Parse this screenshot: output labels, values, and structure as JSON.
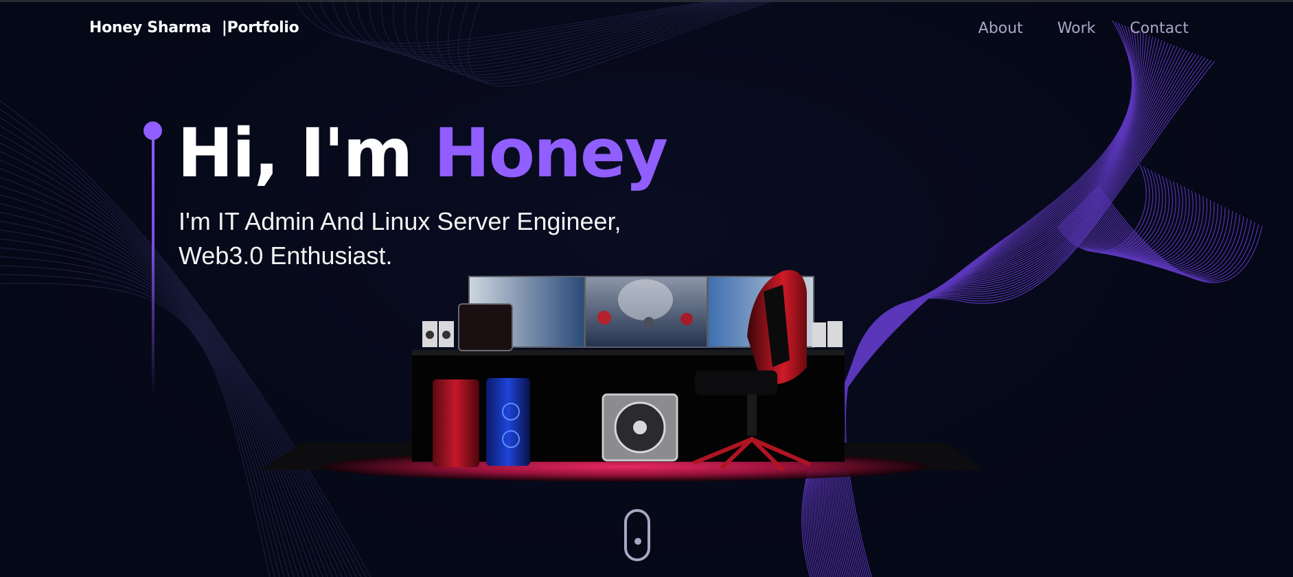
{
  "header": {
    "brand": "Honey Sharma",
    "separator": "|",
    "brand_suffix": "Portfolio",
    "nav": [
      {
        "label": "About"
      },
      {
        "label": "Work"
      },
      {
        "label": "Contact"
      }
    ]
  },
  "hero": {
    "greeting": "Hi, I'm",
    "name": "Honey",
    "subtitle_line1": "I'm IT Admin And Linux Server Engineer,",
    "subtitle_line2": "Web3.0 Enthusiast."
  },
  "scene": {
    "description_icon": "gaming-desk-setup-3d"
  },
  "colors": {
    "background": "#050816",
    "accent": "#915eff",
    "nav_text": "#a9a7c7",
    "text": "#ffffff"
  },
  "icons": {
    "scroll": "mouse-scroll-icon"
  }
}
